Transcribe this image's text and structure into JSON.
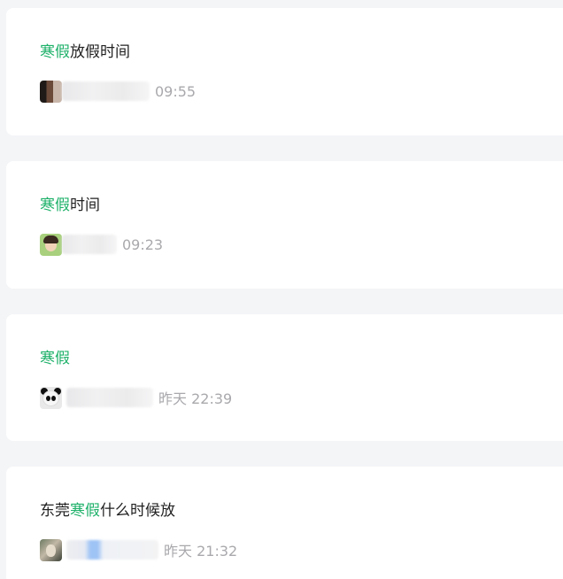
{
  "results": [
    {
      "title_pre": "",
      "title_highlight": "寒假",
      "title_post": "放假时间",
      "author_avatar_icon": "user-avatar-photo",
      "time": "09:55"
    },
    {
      "title_pre": "",
      "title_highlight": "寒假",
      "title_post": "时间",
      "author_avatar_icon": "user-avatar-cartoon-girl",
      "time": "09:23"
    },
    {
      "title_pre": "",
      "title_highlight": "寒假",
      "title_post": "",
      "author_avatar_icon": "user-avatar-panda",
      "time": "昨天 22:39"
    },
    {
      "title_pre": "东莞",
      "title_highlight": "寒假",
      "title_post": "什么时候放",
      "author_avatar_icon": "user-avatar-dog",
      "time": "昨天 21:32"
    }
  ],
  "colors": {
    "highlight": "#1fb16a",
    "title_text": "#222222",
    "meta_text": "#a9a9ad",
    "card_bg": "#ffffff",
    "page_bg": "#f4f5f7"
  }
}
